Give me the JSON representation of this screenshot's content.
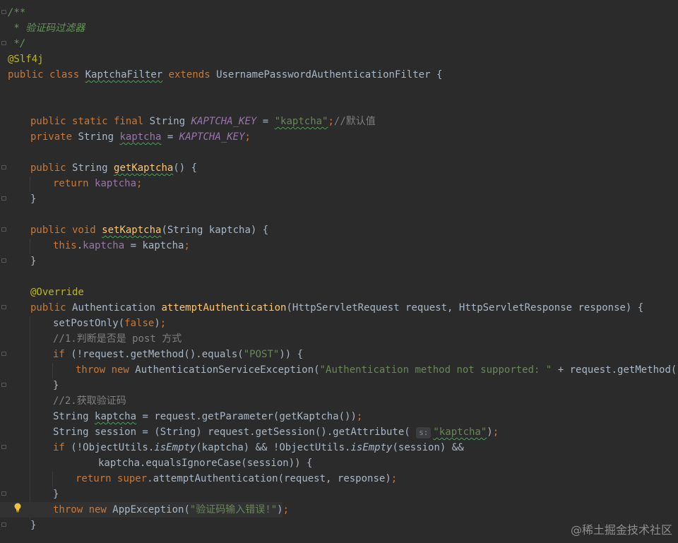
{
  "code_lines": [
    "/**",
    " * 验证码过滤器",
    " */",
    "@Slf4j",
    "public class KaptchaFilter extends UsernamePasswordAuthenticationFilter {",
    "",
    "",
    "    public static final String KAPTCHA_KEY = \"kaptcha\";//默认值",
    "    private String kaptcha = KAPTCHA_KEY;",
    "",
    "    public String getKaptcha() {",
    "        return kaptcha;",
    "    }",
    "",
    "    public void setKaptcha(String kaptcha) {",
    "        this.kaptcha = kaptcha;",
    "    }",
    "",
    "    @Override",
    "    public Authentication attemptAuthentication(HttpServletRequest request, HttpServletResponse response) {",
    "        setPostOnly(false);",
    "        //1.判断是否是 post 方式",
    "        if (!request.getMethod().equals(\"POST\")) {",
    "            throw new AuthenticationServiceException(\"Authentication method not supported: \" + request.getMethod());",
    "        }",
    "        //2.获取验证码",
    "        String kaptcha = request.getParameter(getKaptcha());",
    "        String session = (String) request.getSession().getAttribute( s: \"kaptcha\");",
    "        if (!ObjectUtils.isEmpty(kaptcha) && !ObjectUtils.isEmpty(session) &&",
    "                kaptcha.equalsIgnoreCase(session)) {",
    "            return super.attemptAuthentication(request, response);",
    "        }",
    "        throw new AppException(\"验证码输入错误!\");",
    "    }"
  ],
  "tokens": {
    "l1": "/**",
    "l2": " * 验证码过滤器",
    "l3": " */",
    "l4": "@Slf4j",
    "l5_public": "public",
    "l5_class": "class",
    "l5_name": "KaptchaFilter",
    "l5_extends": "extends",
    "l5_parent": "UsernamePasswordAuthenticationFilter {",
    "l8_mods": "public static final",
    "l8_type": "String",
    "l8_const": "KAPTCHA_KEY",
    "l8_eq": " = ",
    "l8_str": "\"kaptcha\"",
    "l8_semi": ";",
    "l8_comment": "//默认值",
    "l9_mod": "private",
    "l9_type": "String",
    "l9_field": "kaptcha",
    "l9_eq": " = ",
    "l9_const": "KAPTCHA_KEY",
    "l9_semi": ";",
    "l11_mod": "public",
    "l11_type": "String",
    "l11_name": "getKaptcha",
    "l11_rest": "() {",
    "l12_ret": "return",
    "l12_field": "kaptcha",
    "l12_semi": ";",
    "close": "}",
    "l15_mods": "public void",
    "l15_name": "setKaptcha",
    "l15_rest": "(String kaptcha) {",
    "l16_this": "this",
    "l16_dot": ".",
    "l16_field": "kaptcha",
    "l16_rest": " = kaptcha",
    "l16_semi": ";",
    "l19_ann": "@Override",
    "l20_mod": "public",
    "l20_type": "Authentication",
    "l20_name": "attemptAuthentication",
    "l20_rest": "(HttpServletRequest request, HttpServletResponse response) {",
    "l21_a": "setPostOnly(",
    "l21_kw": "false",
    "l21_b": ")",
    "l21_semi": ";",
    "l22_comment": "//1.判断是否是 post 方式",
    "l23_if": "if",
    "l23_a": " (!request.getMethod().equals(",
    "l23_str": "\"POST\"",
    "l23_b": ")) {",
    "l24_throw": "throw new",
    "l24_a": "AuthenticationServiceException(",
    "l24_str": "\"Authentication method not supported: \"",
    "l24_b": " + request.getMethod())",
    "l24_semi": ";",
    "l26_comment": "//2.获取验证码",
    "l27_type": "String ",
    "l27_var": "kaptcha",
    "l27_rest": " = request.getParameter(getKaptcha())",
    "l27_semi": ";",
    "l28_a": "String session = (String) request.getSession().getAttribute(",
    "l28_hint": "s:",
    "l28_str": "\"kaptcha\"",
    "l28_b": ")",
    "l28_semi": ";",
    "l29_if": "if",
    "l29_a": " (!ObjectUtils.",
    "l29_m1": "isEmpty",
    "l29_b": "(kaptcha) && !ObjectUtils.",
    "l29_m2": "isEmpty",
    "l29_c": "(session) &&",
    "l30": "kaptcha.equalsIgnoreCase(session)) {",
    "l31_ret": "return",
    "l31_super": "super",
    "l31_a": ".attemptAuthentication(request, response)",
    "l31_semi": ";",
    "l33_throw": "throw new",
    "l33_a": "AppException(",
    "l33_str": "\"验证码输入错误!\"",
    "l33_b": ")",
    "l33_semi": ";"
  },
  "watermark": "@稀土掘金技术社区",
  "colors": {
    "background": "#2b2b2b",
    "keyword": "#cc7832",
    "string": "#6a8759",
    "comment": "#808080",
    "doc_comment": "#629755",
    "annotation": "#bbb529",
    "method": "#ffc66d",
    "field": "#9876aa",
    "text": "#a9b7c6"
  },
  "icons": [
    "fold-marker-icon",
    "intention-bulb-icon"
  ]
}
